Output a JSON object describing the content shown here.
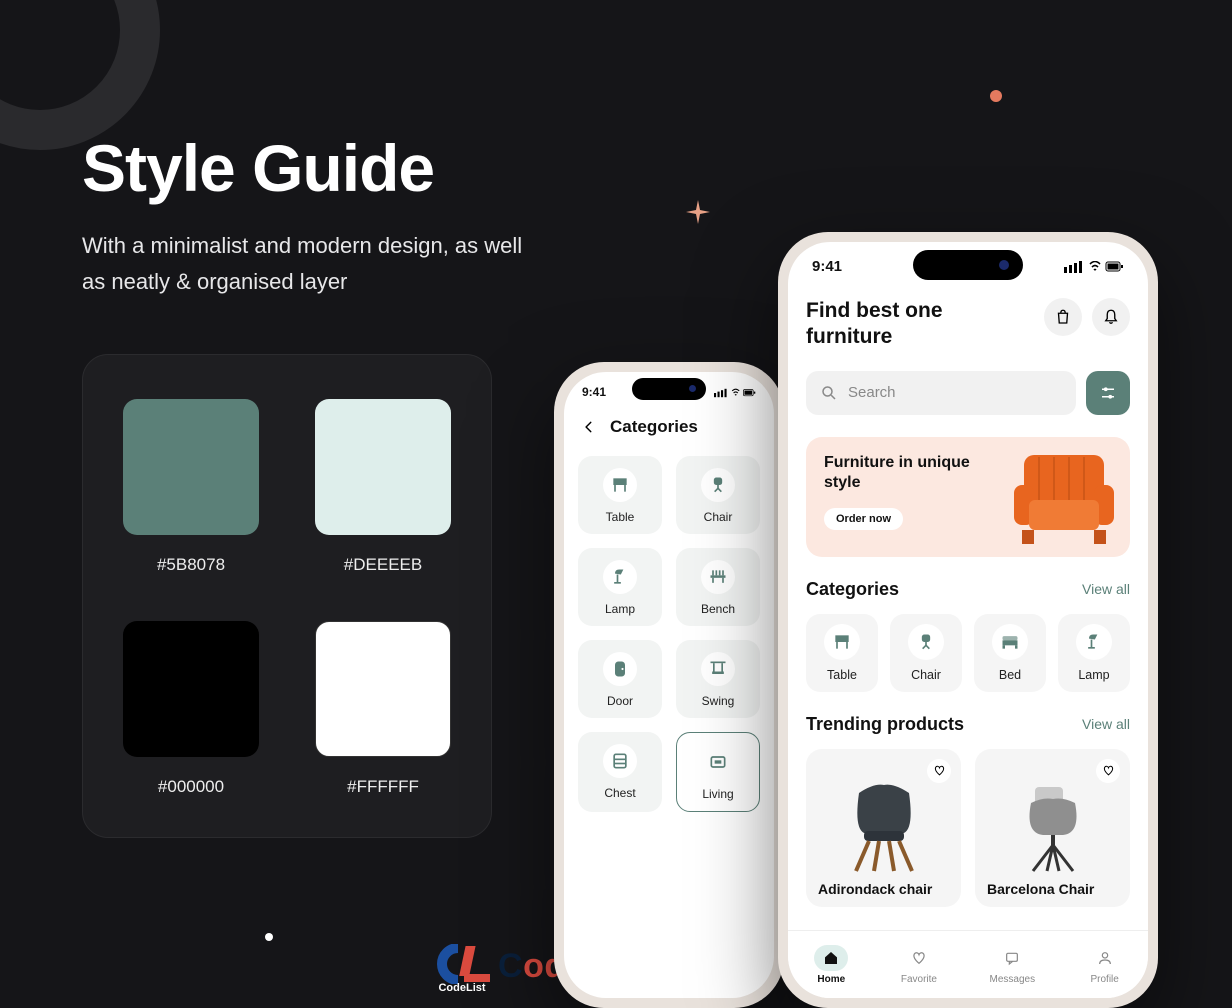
{
  "headline": {
    "title": "Style Guide",
    "subtitle": "With a minimalist and modern design, as well as neatly & organised layer"
  },
  "palette": [
    {
      "hex": "#5B8078"
    },
    {
      "hex": "#DEEEEB"
    },
    {
      "hex": "#000000"
    },
    {
      "hex": "#FFFFFF"
    }
  ],
  "phone_home": {
    "status_time": "9:41",
    "title_line1": "Find best one",
    "title_line2": "furniture",
    "search_placeholder": "Search",
    "banner_title": "Furniture in unique style",
    "banner_button": "Order now",
    "section_categories": "Categories",
    "section_trending": "Trending products",
    "view_all": "View all",
    "categories": [
      "Table",
      "Chair",
      "Bed",
      "Lamp"
    ],
    "products": [
      "Adirondack chair",
      "Barcelona Chair"
    ],
    "tabs": [
      "Home",
      "Favorite",
      "Messages",
      "Profile"
    ]
  },
  "phone_categories": {
    "status_time": "9:41",
    "title": "Categories",
    "items": [
      "Table",
      "Chair",
      "Lamp",
      "Bench",
      "Door",
      "Swing",
      "Chest",
      "Living"
    ]
  },
  "watermark": {
    "brand": "CodeList",
    "text": "CodeList.in"
  }
}
